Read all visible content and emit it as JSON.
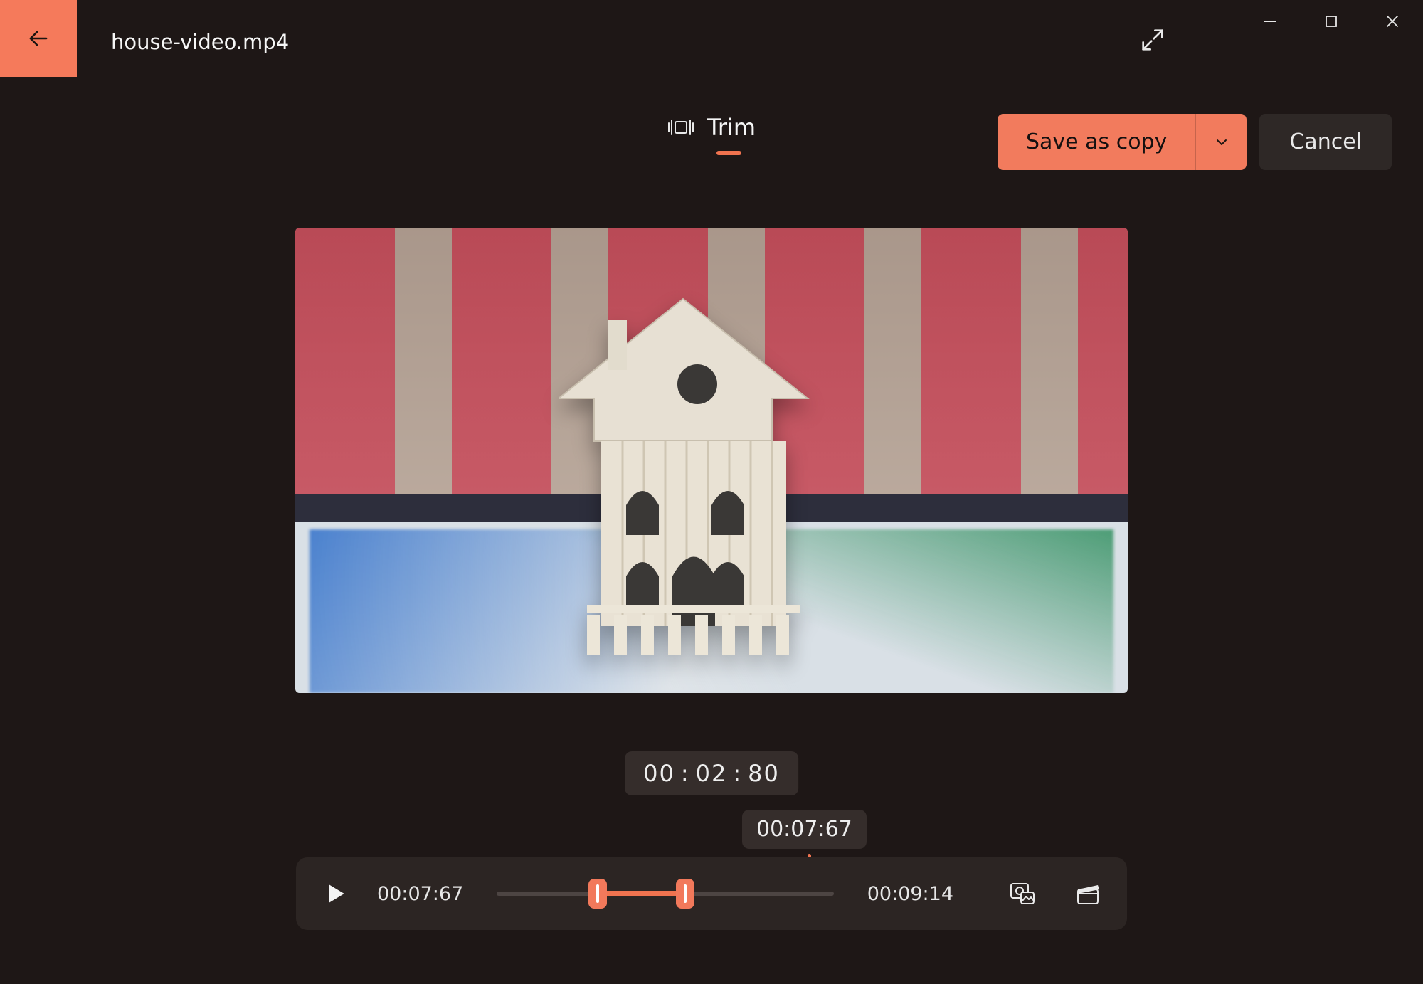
{
  "file_name": "house-video.mp4",
  "mode": {
    "label": "Trim"
  },
  "actions": {
    "save_label": "Save as copy",
    "cancel_label": "Cancel"
  },
  "duration_badge": {
    "hh": "00",
    "mm": "02",
    "ss": "80"
  },
  "playhead_tooltip": "00:07:67",
  "timecodes": {
    "current": "00:07:67",
    "total": "00:09:14"
  },
  "trim": {
    "start_pct": 30,
    "end_pct": 56
  },
  "colors": {
    "accent": "#f2795b"
  }
}
